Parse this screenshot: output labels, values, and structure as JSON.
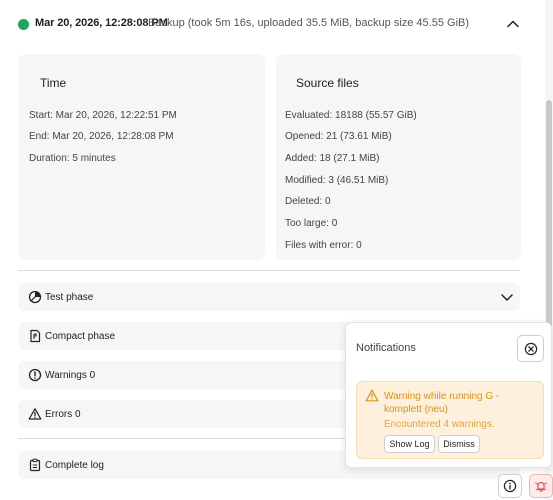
{
  "header": {
    "date": "Mar 20, 2026, 12:28:08 PM",
    "summary": "Backup (took 5m 16s, uploaded 35.5 MiB, backup size 45.55 GiB)",
    "status_color": "#22a35c"
  },
  "time_card": {
    "title": "Time",
    "start": "Start: Mar 20, 2026, 12:22:51 PM",
    "end": "End: Mar 20, 2026, 12:28:08 PM",
    "duration": "Duration: 5 minutes"
  },
  "source_card": {
    "title": "Source files",
    "lines": [
      "Evaluated: 18188 (55.57 GiB)",
      "Opened: 21 (73.61 MiB)",
      "Added: 18 (27.1 MiB)",
      "Modified: 3 (46.51 MiB)",
      "Deleted: 0",
      "Too large: 0",
      "Files with error: 0"
    ]
  },
  "phases": {
    "test": "Test phase",
    "compact": "Compact phase",
    "warnings": "Warnings 0",
    "errors": "Errors 0",
    "log": "Complete log"
  },
  "notifications": {
    "title": "Notifications",
    "warning": {
      "title": "Warning while running G - komplett (neu)",
      "message": "Encountered 4 warnings.",
      "show_log": "Show Log",
      "dismiss": "Dismiss",
      "accent_color": "#d99518"
    }
  },
  "icons": {
    "info": "info-icon",
    "alarm": "alarm-bell-icon"
  }
}
